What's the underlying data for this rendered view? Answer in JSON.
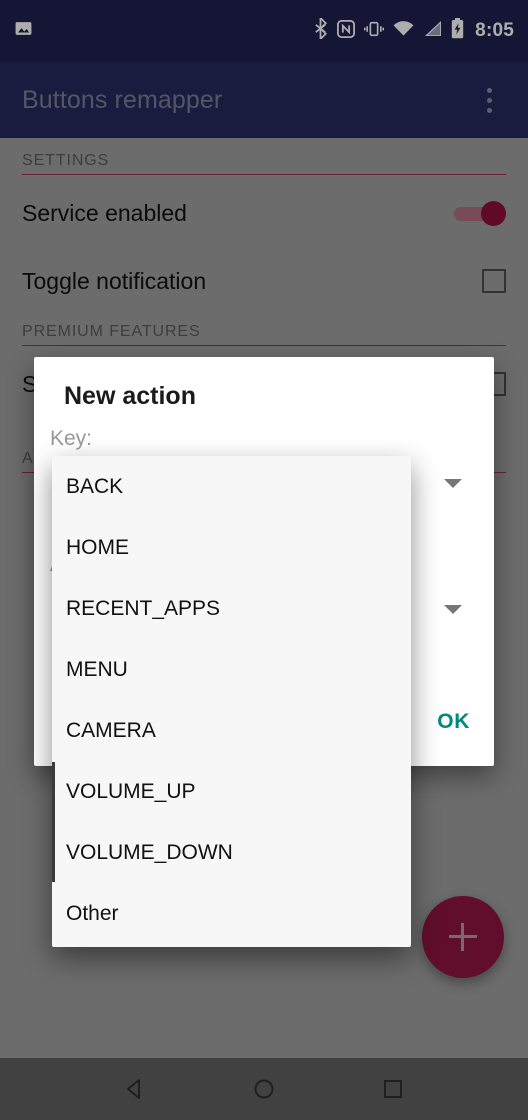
{
  "status_bar": {
    "icons": [
      "image-icon",
      "bluetooth-icon",
      "nfc-icon",
      "vibrate-icon",
      "wifi-icon",
      "cell-signal-icon",
      "battery-charging-icon"
    ],
    "time": "8:05"
  },
  "app_bar": {
    "title": "Buttons remapper",
    "overflow_icon": "overflow-menu-icon"
  },
  "settings": {
    "section_label": "SETTINGS",
    "rows": [
      {
        "label": "Service enabled",
        "control": "switch",
        "state": "on"
      },
      {
        "label": "Toggle notification",
        "control": "checkbox",
        "state": "off"
      }
    ]
  },
  "premium": {
    "section_label": "PREMIUM FEATURES",
    "rows": [
      {
        "label": "Show in notification",
        "control": "checkbox",
        "state": "off"
      }
    ]
  },
  "actions": {
    "section_label": "ACTIONS"
  },
  "fab": {
    "icon": "plus-icon",
    "label": "+"
  },
  "nav_bar": {
    "back": "back-triangle-icon",
    "home": "home-circle-icon",
    "recents": "recents-square-icon"
  },
  "dialog": {
    "title": "New action",
    "key_label": "Key:",
    "key_value": "BACK",
    "action_label": "Action:",
    "action_value": "",
    "ok_label": "OK",
    "caret_icon": "chevron-down-icon"
  },
  "dropdown": {
    "items": [
      "BACK",
      "HOME",
      "RECENT_APPS",
      "MENU",
      "CAMERA",
      "VOLUME_UP",
      "VOLUME_DOWN",
      "Other"
    ]
  },
  "colors": {
    "status_bar": "#1f2150",
    "app_bar": "#252a5c",
    "accent": "#8e0f3c",
    "divider": "#9e3050",
    "ok": "#00897b",
    "scrim": "rgba(0,0,0,0.32)"
  }
}
